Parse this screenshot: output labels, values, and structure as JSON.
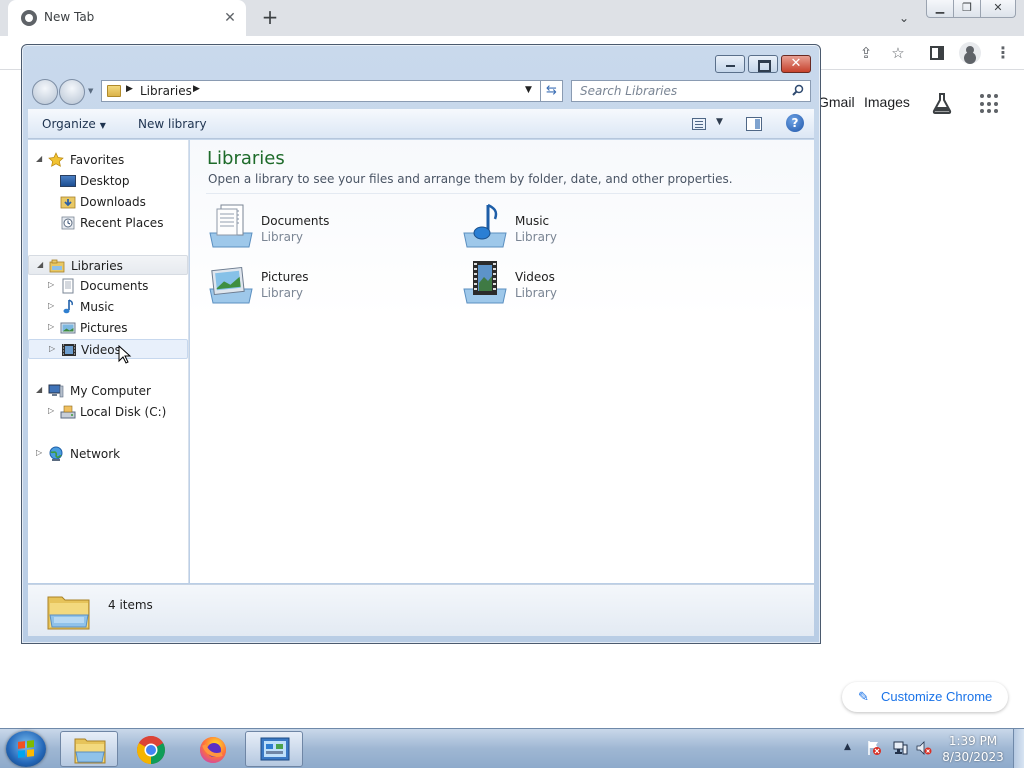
{
  "browser": {
    "tab_title": "New Tab",
    "gmail_label": "Gmail",
    "images_label": "Images",
    "customize_label": "Customize Chrome",
    "new_tab_glyph": "+",
    "tab_close_glyph": "✕",
    "tab_search_glyph": "⌄",
    "kebab_glyph": "⋮",
    "share_glyph": "⇪",
    "star_glyph": "☆",
    "pencil_glyph": "✎",
    "icons": [
      "chrome-favicon",
      "close-icon",
      "new-tab-icon",
      "tab-search-icon",
      "minimize-icon",
      "restore-icon",
      "close-icon",
      "share-icon",
      "bookmark-star-icon",
      "side-panel-icon",
      "profile-icon",
      "menu-kebab-icon",
      "labs-flask-icon",
      "apps-grid-icon",
      "pencil-icon"
    ]
  },
  "explorer": {
    "breadcrumb": "Libraries",
    "search_placeholder": "Search Libraries",
    "organize_label": "Organize",
    "new_library_label": "New library",
    "help_glyph": "?",
    "close_glyph": "✕",
    "refresh_glyph": "⇆",
    "nav": {
      "favorites": "Favorites",
      "desktop": "Desktop",
      "downloads": "Downloads",
      "recent_places": "Recent Places",
      "libraries": "Libraries",
      "documents": "Documents",
      "music": "Music",
      "pictures": "Pictures",
      "videos": "Videos",
      "my_computer": "My Computer",
      "local_disk": "Local Disk (C:)",
      "network": "Network"
    },
    "content": {
      "title": "Libraries",
      "subtitle": "Open a library to see your files and arrange them by folder, date, and other properties.",
      "libraries": [
        {
          "name": "Documents",
          "type": "Library"
        },
        {
          "name": "Music",
          "type": "Library"
        },
        {
          "name": "Pictures",
          "type": "Library"
        },
        {
          "name": "Videos",
          "type": "Library"
        }
      ]
    },
    "status": {
      "item_count": "4 items"
    }
  },
  "taskbar": {
    "time": "1:39 PM",
    "date": "8/30/2023",
    "apps": [
      "windows-explorer",
      "google-chrome",
      "firefox",
      "control-panel"
    ]
  },
  "colors": {
    "content_title": "#1e6b2a",
    "chrome_link": "#1a73e8",
    "taskbar": "#9fb7d3",
    "window_frame": "#b9cde5"
  }
}
